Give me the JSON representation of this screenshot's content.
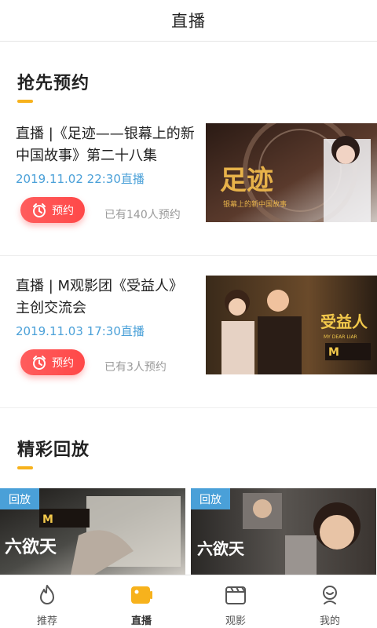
{
  "header": {
    "title": "直播"
  },
  "upcoming": {
    "title": "抢先预约",
    "items": [
      {
        "title": "直播 |《足迹——银幕上的新中国故事》第二十八集",
        "time": "2019.11.02 22:30直播",
        "button_label": "预约",
        "count": "已有140人预约",
        "thumb_caption_logo": "足迹",
        "thumb_caption": "银幕上的新中国故事"
      },
      {
        "title": "直播 | M观影团《受益人》主创交流会",
        "time": "2019.11.03 17:30直播",
        "button_label": "预约",
        "count": "已有3人预约",
        "thumb_caption": "受益人",
        "thumb_caption_en": "MY DEAR LIAR"
      }
    ]
  },
  "replays": {
    "title": "精彩回放",
    "items": [
      {
        "badge": "回放",
        "overlay_text": "六欲天"
      },
      {
        "badge": "回放",
        "overlay_text": "六欲天"
      }
    ]
  },
  "tabbar": {
    "tabs": [
      {
        "label": "推荐",
        "icon": "flame-icon"
      },
      {
        "label": "直播",
        "icon": "live-camera-icon",
        "active": true
      },
      {
        "label": "观影",
        "icon": "clapperboard-icon"
      },
      {
        "label": "我的",
        "icon": "profile-icon"
      }
    ]
  },
  "colors": {
    "accent": "#f7b21c",
    "button": "#ff4d4d",
    "time_blue": "#4aa0d8",
    "badge_blue": "#4aa0d8"
  }
}
